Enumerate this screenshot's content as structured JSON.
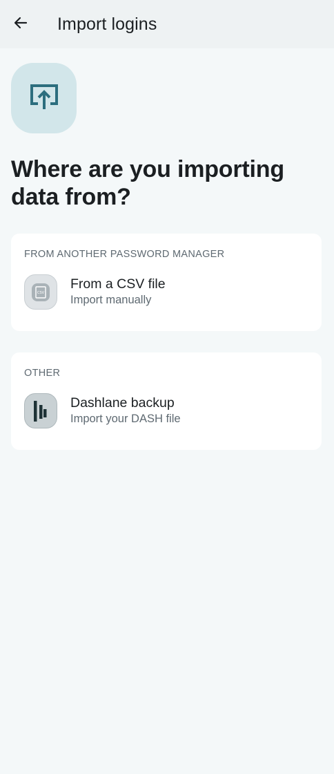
{
  "app_bar": {
    "title": "Import logins",
    "back_icon": "arrow-left-icon"
  },
  "hero": {
    "icon": "import-upload-icon",
    "icon_color": "#2c6e7e",
    "background": "#d2e6ea"
  },
  "headline": "Where are you importing data from?",
  "sections": [
    {
      "header": "FROM ANOTHER PASSWORD MANAGER",
      "item": {
        "icon": "csv-file-icon",
        "title": "From a CSV file",
        "subtitle": "Import manually",
        "icon_text": "CSV"
      }
    },
    {
      "header": "OTHER",
      "item": {
        "icon": "dashlane-logo-icon",
        "title": "Dashlane backup",
        "subtitle": "Import your DASH file"
      }
    }
  ],
  "colors": {
    "background": "#f4f8f9",
    "app_bar": "#eef2f3",
    "card": "#ffffff",
    "text_primary": "#1b1f22",
    "text_secondary": "#5e6971",
    "accent": "#2c6e7e"
  }
}
